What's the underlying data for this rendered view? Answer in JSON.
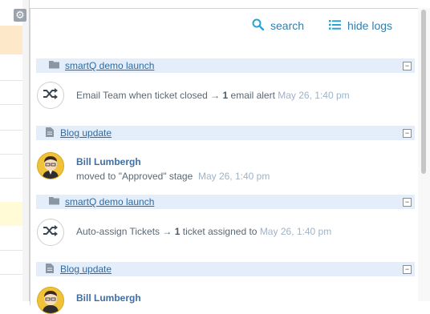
{
  "toolbar": {
    "search_label": "search",
    "hide_logs_label": "hide logs"
  },
  "feed": [
    {
      "group": "smartQ demo launch",
      "group_icon": "folder-icon",
      "entry": {
        "kind": "automation",
        "icon": "shuffle-icon",
        "text_before": "Email Team when ticket closed → ",
        "count": "1",
        "text_after": " email alert",
        "time": "May 26, 1:40 pm"
      }
    },
    {
      "group": "Blog update",
      "group_icon": "document-icon",
      "entry": {
        "kind": "user",
        "name": "Bill Lumbergh",
        "action": "moved to \"Approved\" stage",
        "time": "May 26, 1:40 pm"
      }
    },
    {
      "group": "smartQ demo launch",
      "group_icon": "folder-icon",
      "entry": {
        "kind": "automation",
        "icon": "shuffle-icon",
        "text_before": "Auto-assign Tickets → ",
        "count": "1",
        "text_after": " ticket assigned to",
        "time": "May 26, 1:40 pm"
      }
    },
    {
      "group": "Blog update",
      "group_icon": "document-icon",
      "entry": {
        "kind": "user",
        "name": "Bill Lumbergh"
      }
    }
  ],
  "colors": {
    "accent": "#2aa2d4",
    "link": "#2f6a9e",
    "group_bg": "#e4eefb",
    "timestamp": "#9fb3c8"
  }
}
